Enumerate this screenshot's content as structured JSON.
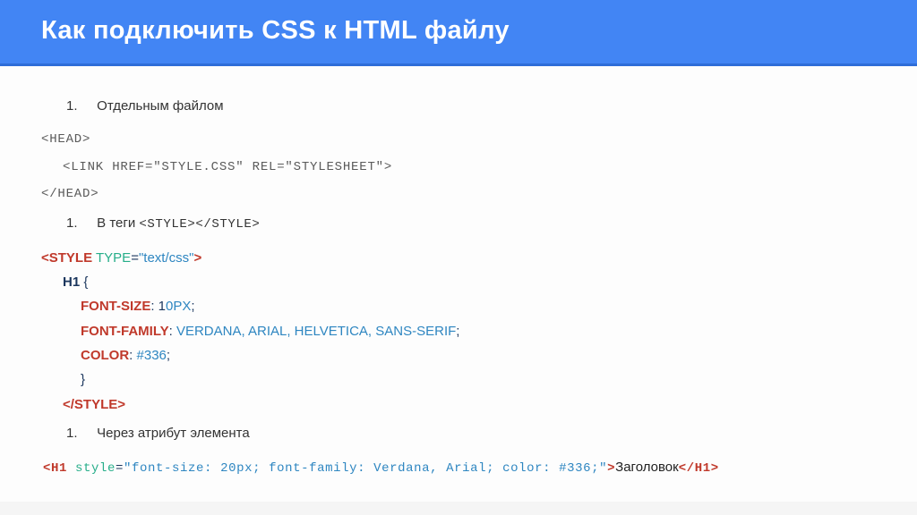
{
  "header": {
    "title": "Как подключить CSS к HTML файлу"
  },
  "items": {
    "i1": {
      "num": "1.",
      "label": "Отдельным файлом"
    },
    "i2": {
      "num": "1.",
      "label_before": "В теги  ",
      "label_code": "<STYLE></STYLE>"
    },
    "i3": {
      "num": "1.",
      "label": "Через атрибут элемента"
    }
  },
  "code1": {
    "l1": "<HEAD>",
    "l2": "<LINK HREF=\"STYLE.CSS\" REL=\"STYLESHEET\">",
    "l3": "</HEAD>"
  },
  "code2": {
    "open_tag": "<STYLE",
    "attr": " TYPE",
    "eq": "=",
    "val": "\"text/css\"",
    "gt": ">",
    "sel": "H1",
    "br_o": " {",
    "p1": "FONT-SIZE",
    "v1a": ": 1",
    "v1b": "0PX",
    "sc": ";",
    "p2": "FONT-FAMILY",
    "v2a": ": ",
    "v2b": "VERDANA, ARIAL, HELVETICA, SANS-SERIF",
    "p3": "COLOR",
    "v3a": ": ",
    "v3b": "#336",
    "br_c": "}",
    "close_tag": "</STYLE>"
  },
  "code3": {
    "open": "<H1",
    "attr": " style",
    "eq": "=",
    "val": "\"font-size: 20px; font-family: Verdana, Arial; color: #336;\"",
    "gt": ">",
    "text": "Заголовок",
    "close": "</H1>"
  }
}
